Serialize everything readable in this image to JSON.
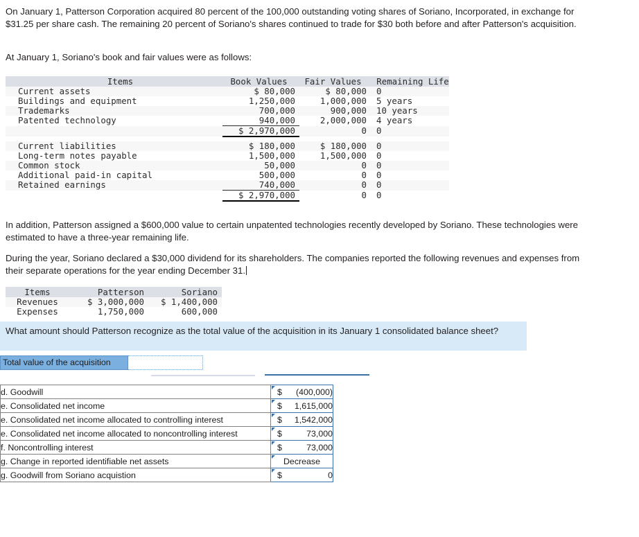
{
  "intro_paragraph": "On January 1, Patterson Corporation acquired 80 percent of the 100,000 outstanding voting shares of Soriano, Incorporated, in exchange for $31.25 per share cash. The remaining 20 percent of Soriano's shares continued to trade for $30 both before and after Patterson's acquisition.",
  "subintro_paragraph": "At January 1, Soriano's book and fair values were as follows:",
  "addition_paragraph": "In addition, Patterson assigned a $600,000 value to certain unpatented technologies recently developed by Soriano. These technologies were estimated to have a three-year remaining life.",
  "during_year_paragraph": "During the year, Soriano declared a $30,000 dividend for its shareholders. The companies reported the following revenues and expenses from their separate operations for the year ending December 31.",
  "values_table": {
    "headers": {
      "items": "Items",
      "book_values": "Book Values",
      "fair_values": "Fair Values",
      "remaining_life": "Remaining Life"
    },
    "asset_rows": [
      {
        "item": "Current assets",
        "book": "$ 80,000",
        "fair": "$ 80,000",
        "life": "0"
      },
      {
        "item": "Buildings and equipment",
        "book": "1,250,000",
        "fair": "1,000,000",
        "life": "5 years"
      },
      {
        "item": "Trademarks",
        "book": "700,000",
        "fair": "900,000",
        "life": "10 years"
      },
      {
        "item": "Patented technology",
        "book": "940,000",
        "fair": "2,000,000",
        "life": "4 years"
      }
    ],
    "asset_total": {
      "item": "",
      "book": "$ 2,970,000",
      "fair": "0",
      "life": "0"
    },
    "liability_rows": [
      {
        "item": "Current liabilities",
        "book": "$ 180,000",
        "fair": "$ 180,000",
        "life": "0"
      },
      {
        "item": "Long-term notes payable",
        "book": "1,500,000",
        "fair": "1,500,000",
        "life": "0"
      },
      {
        "item": "Common stock",
        "book": "50,000",
        "fair": "0",
        "life": "0"
      },
      {
        "item": "Additional paid-in capital",
        "book": "500,000",
        "fair": "0",
        "life": "0"
      },
      {
        "item": "Retained earnings",
        "book": "740,000",
        "fair": "0",
        "life": "0"
      }
    ],
    "liability_total": {
      "item": "",
      "book": "$ 2,970,000",
      "fair": "0",
      "life": "0"
    }
  },
  "revenue_table": {
    "headers": {
      "items": "Items",
      "patterson": "Patterson",
      "soriano": "Soriano"
    },
    "rows": [
      {
        "item": "Revenues",
        "patterson": "$ 3,000,000",
        "soriano": "$ 1,400,000"
      },
      {
        "item": "Expenses",
        "patterson": "1,750,000",
        "soriano": "600,000"
      }
    ]
  },
  "question": {
    "text": "What amount should Patterson recognize as the total value of the acquisition in its January 1 consolidated balance sheet?",
    "highlight_color": "#d8eaf8"
  },
  "answer_entry": {
    "label": "Total value of the acquisition",
    "value": "",
    "placeholder": "",
    "label_color": "#7bafe0"
  },
  "results": {
    "rows": [
      {
        "label": "d. Goodwill",
        "currency": "$",
        "amount": "(400,000)",
        "centered": false
      },
      {
        "label": "e. Consolidated net income",
        "currency": "$",
        "amount": "1,615,000",
        "centered": false
      },
      {
        "label": "e. Consolidated net income allocated to controlling interest",
        "currency": "$",
        "amount": "1,542,000",
        "centered": false
      },
      {
        "label": "e. Consolidated net income allocated to noncontrolling interest",
        "currency": "$",
        "amount": "73,000",
        "centered": false
      },
      {
        "label": "f. Noncontrolling interest",
        "currency": "$",
        "amount": "73,000",
        "centered": false
      },
      {
        "label": "g. Change in reported identifiable net assets",
        "currency": "",
        "amount": "Decrease",
        "centered": true
      },
      {
        "label": "g. Goodwill from Soriano acquistion",
        "currency": "$",
        "amount": "0",
        "centered": false
      }
    ],
    "border_color": "#3b6fa8"
  }
}
